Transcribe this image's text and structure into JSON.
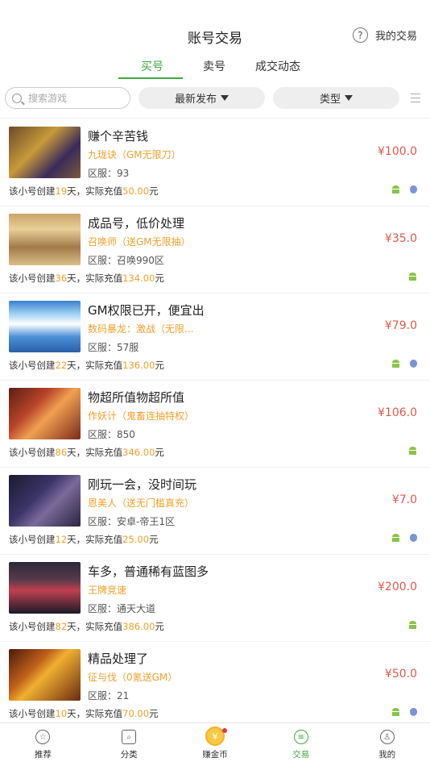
{
  "header": {
    "title": "账号交易",
    "help_icon": "question-circle-icon",
    "my_trade_label": "我的交易"
  },
  "tabs": [
    {
      "label": "买号",
      "active": true
    },
    {
      "label": "卖号",
      "active": false
    },
    {
      "label": "成交动态",
      "active": false
    }
  ],
  "filters": {
    "search_placeholder": "搜索游戏",
    "sort_label": "最新发布",
    "type_label": "类型"
  },
  "colors": {
    "accent": "#3fa83f",
    "price": "#e05a4b",
    "highlight": "#f0a02c"
  },
  "listings": [
    {
      "title": "赚个辛苦钱",
      "game": "九珑诀（GM无限刀）",
      "server": "区服：93",
      "price": "¥100.0",
      "days": "19",
      "recharge": "50.00",
      "android": true,
      "ios": true
    },
    {
      "title": "成品号，低价处理",
      "game": "召唤师（送GM无限抽）",
      "server": "区服：召唤990区",
      "price": "¥35.0",
      "days": "36",
      "recharge": "134.00",
      "android": true,
      "ios": false
    },
    {
      "title": "GM权限已开，便宜出",
      "game": "数码暴龙：激战（无限...",
      "server": "区服：57服",
      "price": "¥79.0",
      "days": "22",
      "recharge": "136.00",
      "android": true,
      "ios": true
    },
    {
      "title": "物超所值物超所值",
      "game": "作妖计（鬼畜连抽特权）",
      "server": "区服：850",
      "price": "¥106.0",
      "days": "86",
      "recharge": "346.00",
      "android": true,
      "ios": false
    },
    {
      "title": "刚玩一会，没时间玩",
      "game": "恩美人（送无门槛真充）",
      "server": "区服：安卓-帝王1区",
      "price": "¥7.0",
      "days": "12",
      "recharge": "25.00",
      "android": true,
      "ios": true
    },
    {
      "title": "车多，普通稀有蓝图多",
      "game": "王牌竞速",
      "server": "区服：通天大道",
      "price": "¥200.0",
      "days": "82",
      "recharge": "386.00",
      "android": true,
      "ios": false
    },
    {
      "title": "精品处理了",
      "game": "征与伐（0氪送GM）",
      "server": "区服：21",
      "price": "¥50.0",
      "days": "10",
      "recharge": "70.00",
      "android": true,
      "ios": true
    }
  ],
  "meta_text": {
    "prefix": "该小号创建",
    "days_unit": "天，实际充值",
    "currency_unit": "元"
  },
  "bottom_nav": [
    {
      "label": "推荐",
      "icon": "star-icon",
      "active": false
    },
    {
      "label": "分类",
      "icon": "category-scan-icon",
      "active": false
    },
    {
      "label": "赚金币",
      "icon": "coin-icon",
      "active": false,
      "badge": true
    },
    {
      "label": "交易",
      "icon": "trade-icon",
      "active": true
    },
    {
      "label": "我的",
      "icon": "person-icon",
      "active": false
    }
  ]
}
